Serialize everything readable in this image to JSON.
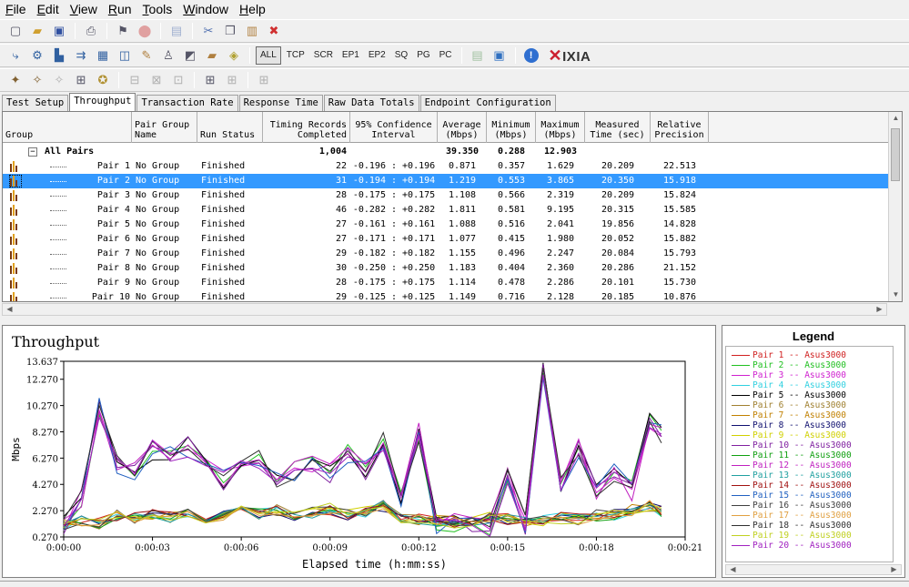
{
  "menu": [
    {
      "pre": "",
      "u": "F",
      "post": "ile"
    },
    {
      "pre": "",
      "u": "E",
      "post": "dit"
    },
    {
      "pre": "",
      "u": "V",
      "post": "iew"
    },
    {
      "pre": "",
      "u": "R",
      "post": "un"
    },
    {
      "pre": "",
      "u": "T",
      "post": "ools"
    },
    {
      "pre": "",
      "u": "W",
      "post": "indow"
    },
    {
      "pre": "",
      "u": "H",
      "post": "elp"
    }
  ],
  "toolbar2_text": [
    "ALL",
    "TCP",
    "SCR",
    "EP1",
    "EP2",
    "SQ",
    "PG",
    "PC"
  ],
  "brand": "IXIA",
  "tabs": [
    "Test Setup",
    "Throughput",
    "Transaction Rate",
    "Response Time",
    "Raw Data Totals",
    "Endpoint Configuration"
  ],
  "columns": [
    [
      "Group",
      ""
    ],
    [
      "Pair Group",
      "Name"
    ],
    [
      "Run Status",
      ""
    ],
    [
      "Timing Records",
      "Completed"
    ],
    [
      "95% Confidence",
      "Interval"
    ],
    [
      "Average",
      "(Mbps)"
    ],
    [
      "Minimum",
      "(Mbps)"
    ],
    [
      "Maximum",
      "(Mbps)"
    ],
    [
      "Measured",
      "Time (sec)"
    ],
    [
      "Relative",
      "Precision"
    ]
  ],
  "summary": {
    "expander": "−",
    "label": "All Pairs",
    "records": "1,004",
    "avg": "39.350",
    "min": "0.288",
    "max": "12.903"
  },
  "pairs": [
    [
      "Pair 1",
      "No Group",
      "Finished",
      "22",
      "-0.196 : +0.196",
      "0.871",
      "0.357",
      "1.629",
      "20.209",
      "22.513"
    ],
    [
      "Pair 2",
      "No Group",
      "Finished",
      "31",
      "-0.194 : +0.194",
      "1.219",
      "0.553",
      "3.865",
      "20.350",
      "15.918"
    ],
    [
      "Pair 3",
      "No Group",
      "Finished",
      "28",
      "-0.175 : +0.175",
      "1.108",
      "0.566",
      "2.319",
      "20.209",
      "15.824"
    ],
    [
      "Pair 4",
      "No Group",
      "Finished",
      "46",
      "-0.282 : +0.282",
      "1.811",
      "0.581",
      "9.195",
      "20.315",
      "15.585"
    ],
    [
      "Pair 5",
      "No Group",
      "Finished",
      "27",
      "-0.161 : +0.161",
      "1.088",
      "0.516",
      "2.041",
      "19.856",
      "14.828"
    ],
    [
      "Pair 6",
      "No Group",
      "Finished",
      "27",
      "-0.171 : +0.171",
      "1.077",
      "0.415",
      "1.980",
      "20.052",
      "15.882"
    ],
    [
      "Pair 7",
      "No Group",
      "Finished",
      "29",
      "-0.182 : +0.182",
      "1.155",
      "0.496",
      "2.247",
      "20.084",
      "15.793"
    ],
    [
      "Pair 8",
      "No Group",
      "Finished",
      "30",
      "-0.250 : +0.250",
      "1.183",
      "0.404",
      "2.360",
      "20.286",
      "21.152"
    ],
    [
      "Pair 9",
      "No Group",
      "Finished",
      "28",
      "-0.175 : +0.175",
      "1.114",
      "0.478",
      "2.286",
      "20.101",
      "15.730"
    ],
    [
      "Pair 10",
      "No Group",
      "Finished",
      "29",
      "-0.125 : +0.125",
      "1.149",
      "0.716",
      "2.128",
      "20.185",
      "10.876"
    ]
  ],
  "selected_row": 1,
  "chart_title": "Throughput",
  "legend_title": "Legend",
  "colors": {
    "selection": "#3399ff",
    "ixia_red": "#cc1f2f"
  },
  "chart_data": {
    "type": "line",
    "title": "Throughput",
    "xlabel": "Elapsed time (h:mm:ss)",
    "ylabel": "Mbps",
    "ylim": [
      0.27,
      13.637
    ],
    "xlim": [
      0,
      21
    ],
    "y_ticks": [
      "0.270",
      "2.270",
      "4.270",
      "6.270",
      "8.270",
      "10.270",
      "12.270",
      "13.637"
    ],
    "x_ticks": [
      "0:00:00",
      "0:00:03",
      "0:00:06",
      "0:00:09",
      "0:00:12",
      "0:00:15",
      "0:00:18",
      "0:00:21"
    ],
    "grid": false,
    "series": [
      {
        "name": "Pair 1 -- Asus3000",
        "color": "#d02020"
      },
      {
        "name": "Pair 2 -- Asus3000",
        "color": "#20c020"
      },
      {
        "name": "Pair 3 -- Asus3000",
        "color": "#d020d0"
      },
      {
        "name": "Pair 4 -- Asus3000",
        "color": "#30d0e0"
      },
      {
        "name": "Pair 5 -- Asus3000",
        "color": "#000000"
      },
      {
        "name": "Pair 6 -- Asus3000",
        "color": "#a08030"
      },
      {
        "name": "Pair 7 -- Asus3000",
        "color": "#c08000"
      },
      {
        "name": "Pair 8 -- Asus3000",
        "color": "#101070"
      },
      {
        "name": "Pair 9 -- Asus3000",
        "color": "#d0d000"
      },
      {
        "name": "Pair 10 -- Asus3000",
        "color": "#8020a0"
      },
      {
        "name": "Pair 11 -- Asus3000",
        "color": "#10a010"
      },
      {
        "name": "Pair 12 -- Asus3000",
        "color": "#c020c0"
      },
      {
        "name": "Pair 13 -- Asus3000",
        "color": "#20a0a0"
      },
      {
        "name": "Pair 14 -- Asus3000",
        "color": "#a01010"
      },
      {
        "name": "Pair 15 -- Asus3000",
        "color": "#2060c0"
      },
      {
        "name": "Pair 16 -- Asus3000",
        "color": "#404040"
      },
      {
        "name": "Pair 17 -- Asus3000",
        "color": "#e0a040"
      },
      {
        "name": "Pair 18 -- Asus3000",
        "color": "#303030"
      },
      {
        "name": "Pair 19 -- Asus3000",
        "color": "#c0d020"
      },
      {
        "name": "Pair 20 -- Asus3000",
        "color": "#a020c0"
      }
    ],
    "approx_series_values": {
      "x": [
        0,
        0.6,
        1.2,
        1.8,
        2.4,
        3.0,
        3.6,
        4.2,
        4.8,
        5.4,
        6.0,
        6.6,
        7.2,
        7.8,
        8.4,
        9.0,
        9.6,
        10.2,
        10.8,
        11.4,
        12.0,
        12.6,
        13.2,
        13.8,
        14.4,
        15.0,
        15.6,
        16.2,
        16.8,
        17.4,
        18.0,
        18.6,
        19.2,
        19.8,
        20.2
      ],
      "high_group_example": [
        1.2,
        3.2,
        10.1,
        5.9,
        5.4,
        6.9,
        6.7,
        7.1,
        6.2,
        4.6,
        5.3,
        6.1,
        4.4,
        5.2,
        6.0,
        5.2,
        6.7,
        5.3,
        7.6,
        3.3,
        8.2,
        1.1,
        1.4,
        1.3,
        1.1,
        5.1,
        1.2,
        13.1,
        4.3,
        7.1,
        3.6,
        5.1,
        3.8,
        9.3,
        8.1
      ],
      "low_group_example": [
        1.2,
        1.5,
        1.3,
        1.9,
        1.7,
        2.0,
        1.8,
        2.1,
        1.6,
        1.9,
        2.2,
        2.0,
        2.3,
        1.8,
        2.1,
        2.4,
        2.0,
        2.2,
        2.6,
        1.8,
        1.6,
        1.5,
        1.4,
        1.5,
        1.7,
        1.6,
        1.4,
        1.5,
        1.7,
        1.6,
        1.9,
        2.0,
        2.3,
        2.6,
        2.2
      ]
    }
  }
}
